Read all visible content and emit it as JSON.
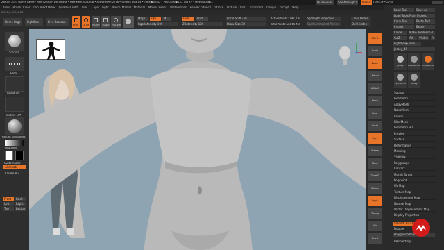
{
  "title_bar": {
    "text": "ZBrush 2021 [Soren Berkey Here]  ZBrush Document   • Free Mem 4.283GB • Active Mem 2278 • Scratch Disk 84 • Timer▶0.002 • PolyCount▶157.746 KP • MeshCount▶3",
    "quicksave": "QuickSave",
    "see_through": "See-through 0",
    "menus_toggle": "Menus",
    "default_script": "DefaultZScript"
  },
  "menu_bar": [
    "Alpha",
    "Brush",
    "Color",
    "Document",
    "Draw",
    "Dynamics",
    "Edit",
    "File",
    "Layer",
    "Light",
    "Macro",
    "Marker",
    "Material",
    "Movie",
    "Picker",
    "Preferences",
    "Render",
    "Stencil",
    "Stroke",
    "Texture",
    "Tool",
    "Transform",
    "Zplugin",
    "Zscript",
    "Help"
  ],
  "status_line": "0.021,0.475,-0.06",
  "top_shelf": {
    "home_page": "Home Page",
    "lightbox": "LightBox",
    "live_boolean": "Live Boolean",
    "edit": "Edit",
    "draw": "Draw",
    "move": "Move",
    "scale": "Scale",
    "rotate": "Rotate",
    "mrgb": "Mrgb",
    "rgb": "Rgb",
    "m": "M",
    "rgb_intensity": "Rgb Intensity 100",
    "zadd": "Zadd",
    "zsub": "Zsub",
    "z_intensity": "Z Intensity 100",
    "focal_shift": "Focal Shift -50",
    "draw_size": "Draw Size 39",
    "active_points": "ActivePoints: 197,734",
    "total_points": "TotalPoints: 2.866 Mil",
    "spotlight_projection": "Spotlight Projection",
    "split_unmasked": "Split Unmasked Points",
    "close_holes": "Close Holes",
    "del_hidden": "Del Hidden"
  },
  "left_shelf": {
    "smooth": "Smooth",
    "dots": "Dots",
    "alpha_off": "Alpha Off",
    "texture_off": "Texture Off",
    "material": "MatCap_SkinShade4",
    "gradient": "Gradient",
    "switch_color": "SwitchColor",
    "alternate": "Alternate",
    "create_pg": "Create PG",
    "view_buttons": [
      "Front",
      "Back",
      "Left",
      "Right",
      "Top",
      "Bottom"
    ]
  },
  "right_rib": {
    "spix": "SPix 3",
    "scroll": "Scroll",
    "zoom": "Zoom",
    "actual": "Actual",
    "aahalf": "AAHalf",
    "persp": "Persp",
    "floor": "Floor",
    "local": "Local",
    "xyz": "Gxyz",
    "frame": "Frame",
    "move": "Move",
    "scale": "ZoomD",
    "rotate": "Rotate",
    "polyf": "PolyF",
    "transp": "Transp",
    "solo": "Solo",
    "ghost": "Ghost"
  },
  "tool_palette": {
    "load_tool": "Load Tool",
    "save_as": "Save As",
    "load_tools_from_project": "Load Tools From Project",
    "copy_tool": "Copy Tool",
    "paste_tool": "Paste Tool",
    "import": "Import",
    "export": "Export",
    "clone": "Clone",
    "make_polymesh3d": "Make PolyMesh3D",
    "goz": "GoZ",
    "all": "All",
    "visible": "Visible",
    "r": "R",
    "lightbox_tools": "Lightbox▶Tools",
    "jersey": "jersey_49",
    "thumbs": [
      "jersey",
      "PolyMesh3D",
      "SimpleBrush",
      "Cylinder3D",
      "jersey"
    ],
    "subtools": [
      "Subtool",
      "Geometry",
      "ArrayMesh",
      "NanoMesh",
      "Layers",
      "FiberMesh",
      "Geometry HD",
      "Preview",
      "Surface",
      "Deformation",
      "Masking",
      "Visibility",
      "Polygroups",
      "Contact",
      "Morph Target",
      "Polypaint",
      "UV Map",
      "Texture Map",
      "Displacement Map",
      "Normal Map",
      "Vector Displacement Map",
      "Display Properties"
    ],
    "smooth_bottom": "Smooth Brush",
    "double": "Double",
    "polygons_show": "Polygons Show Color",
    "bpr_settings": "BPR Settings"
  },
  "colors": {
    "accent": "#e8742a",
    "canvas": "#8fa4b2",
    "panel": "#2e2e2e",
    "logo_red": "#d21b1b"
  }
}
